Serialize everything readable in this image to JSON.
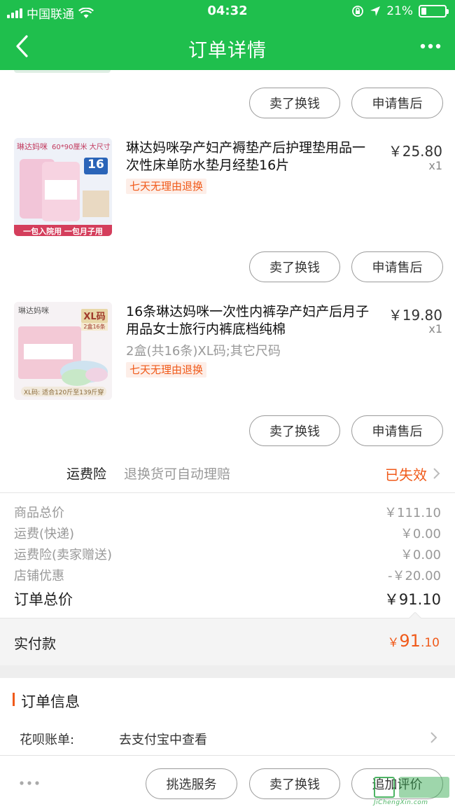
{
  "status": {
    "carrier": "中国联通",
    "time": "04:32",
    "battery": "21%",
    "battery_level": 0.21
  },
  "nav": {
    "title": "订单详情"
  },
  "buttons": {
    "sell": "卖了换钱",
    "after_sale": "申请售后",
    "pick_service": "挑选服务",
    "review": "追加评价"
  },
  "products": [
    {
      "title": "琳达妈咪孕产妇产褥垫产后护理垫用品一次性床单防水垫月经垫16片",
      "price": "￥25.80",
      "qty": "x1",
      "tag": "七天无理由退换",
      "thumb": {
        "brand": "琳达妈咪",
        "size": "60*90厘米 大尺寸",
        "count": "16",
        "unit": "片",
        "banner": "一包入院用 一包月子用"
      }
    },
    {
      "title": "16条琳达妈咪一次性内裤孕产妇产后月子用品女士旅行内裤底档纯棉",
      "price": "￥19.80",
      "qty": "x1",
      "spec": "2盒(共16条)XL码;其它尺码",
      "tag": "七天无理由退换",
      "thumb": {
        "brand": "琳达妈咪",
        "size": "XL码",
        "sub": "2盒16条",
        "banner": "XL码: 适合120斤至139斤穿"
      }
    }
  ],
  "insurance": {
    "label": "运费险",
    "desc": "退换货可自动理赔",
    "status": "已失效"
  },
  "summary": [
    {
      "label": "商品总价",
      "value": "￥111.10"
    },
    {
      "label": "运费(快递)",
      "value": "￥0.00"
    },
    {
      "label": "运费险(卖家赠送)",
      "value": "￥0.00"
    },
    {
      "label": "店铺优惠",
      "value": "-￥20.00"
    }
  ],
  "total": {
    "label": "订单总价",
    "value": "￥91.10"
  },
  "paid": {
    "label": "实付款",
    "currency": "￥",
    "integer": "91",
    "decimal": ".10"
  },
  "order_info": {
    "title": "订单信息",
    "huabei_label": "花呗账单:",
    "huabei_value": "去支付宝中查看"
  },
  "watermark": {
    "text": "JiChengXin.com"
  },
  "colors": {
    "green": "#1fbf4d",
    "orange": "#f05a1a"
  }
}
